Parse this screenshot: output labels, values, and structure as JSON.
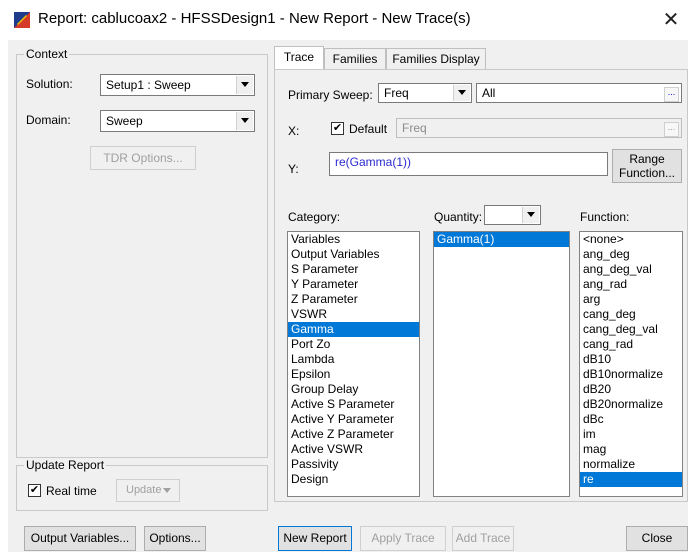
{
  "window": {
    "title": "Report: cablucoax2 - HFSSDesign1 - New Report - New Trace(s)",
    "close_glyph": "✕"
  },
  "context": {
    "group_label": "Context",
    "solution_label": "Solution:",
    "solution_value": "Setup1 : Sweep",
    "domain_label": "Domain:",
    "domain_value": "Sweep",
    "tdr_button": "TDR Options..."
  },
  "update_report": {
    "group_label": "Update Report",
    "realtime_label": "Real time",
    "realtime_checked": true,
    "update_button": "Update"
  },
  "tabs": [
    {
      "label": "Trace",
      "active": true
    },
    {
      "label": "Families",
      "active": false
    },
    {
      "label": "Families Display",
      "active": false
    }
  ],
  "trace": {
    "primary_sweep_label": "Primary Sweep:",
    "primary_sweep_value": "Freq",
    "all_value": "All",
    "x_label": "X:",
    "default_label": "Default",
    "default_checked": true,
    "x_value": "Freq",
    "y_label": "Y:",
    "y_value": "re(Gamma(1))",
    "range_function_line1": "Range",
    "range_function_line2": "Function...",
    "category_label": "Category:",
    "quantity_label": "Quantity:",
    "function_label": "Function:",
    "categories": [
      "Variables",
      "Output Variables",
      "S Parameter",
      "Y Parameter",
      "Z Parameter",
      "VSWR",
      "Gamma",
      "Port Zo",
      "Lambda",
      "Epsilon",
      "Group Delay",
      "Active S Parameter",
      "Active Y Parameter",
      "Active Z Parameter",
      "Active VSWR",
      "Passivity",
      "Design"
    ],
    "category_selected": "Gamma",
    "quantities": [
      "Gamma(1)"
    ],
    "quantity_selected": "Gamma(1)",
    "functions": [
      "<none>",
      "ang_deg",
      "ang_deg_val",
      "ang_rad",
      "arg",
      "cang_deg",
      "cang_deg_val",
      "cang_rad",
      "dB10",
      "dB10normalize",
      "dB20",
      "dB20normalize",
      "dBc",
      "im",
      "mag",
      "normalize",
      "re"
    ],
    "function_selected": "re"
  },
  "footer": {
    "output_variables": "Output Variables...",
    "options": "Options...",
    "new_report": "New Report",
    "apply_trace": "Apply Trace",
    "add_trace": "Add Trace",
    "close": "Close"
  },
  "colors": {
    "selection": "#0078d7",
    "dialog_bg": "#f0f0f0",
    "link_text": "#2a2ad0"
  }
}
